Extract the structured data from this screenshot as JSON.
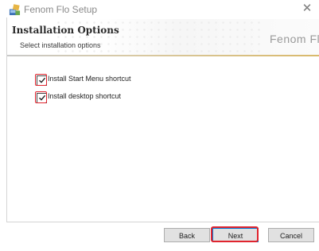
{
  "window": {
    "title": "Fenom Flo Setup",
    "close_glyph": "✕"
  },
  "banner": {
    "title": "Installation Options",
    "subtitle": "Select installation options",
    "brand": "Fenom Flo"
  },
  "options": [
    {
      "label": "Install Start Menu shortcut",
      "checked": true
    },
    {
      "label": "Install desktop shortcut",
      "checked": true
    }
  ],
  "buttons": {
    "back": "Back",
    "next": "Next",
    "cancel": "Cancel"
  },
  "colors": {
    "highlight": "#e0242e",
    "accent_line": "#d9b96b"
  }
}
